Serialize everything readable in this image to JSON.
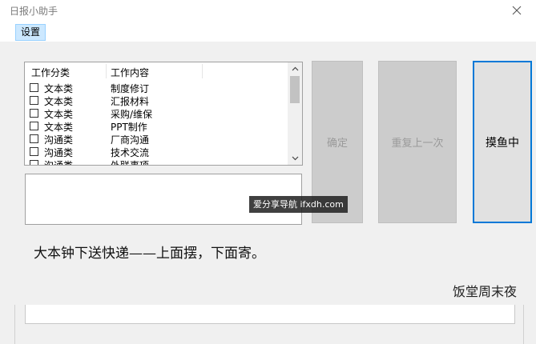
{
  "window": {
    "title": "日报小助手"
  },
  "menu": {
    "settings_label": "设置"
  },
  "task_list": {
    "columns": [
      "工作分类",
      "工作内容"
    ],
    "rows": [
      {
        "category": "文本类",
        "content": "制度修订",
        "checked": false
      },
      {
        "category": "文本类",
        "content": "汇报材料",
        "checked": false
      },
      {
        "category": "文本类",
        "content": "采购/维保",
        "checked": false
      },
      {
        "category": "文本类",
        "content": "PPT制作",
        "checked": false
      },
      {
        "category": "沟通类",
        "content": "厂商沟通",
        "checked": false
      },
      {
        "category": "沟通类",
        "content": "技术交流",
        "checked": false
      },
      {
        "category": "沟通类",
        "content": "外联事项",
        "checked": false
      }
    ]
  },
  "buttons": {
    "confirm_label": "确定",
    "repeat_label": "重复上一次",
    "slack_label": "摸鱼中"
  },
  "watermark": {
    "text": "爱分享导航 ifxdh.com"
  },
  "caption": {
    "main": "大本钟下送快递——上面摆，下面寄。",
    "author": "饭堂周末夜"
  },
  "colors": {
    "accent": "#0078d7",
    "menu_highlight": "#cce8ff",
    "disabled_button": "#cccccc"
  }
}
